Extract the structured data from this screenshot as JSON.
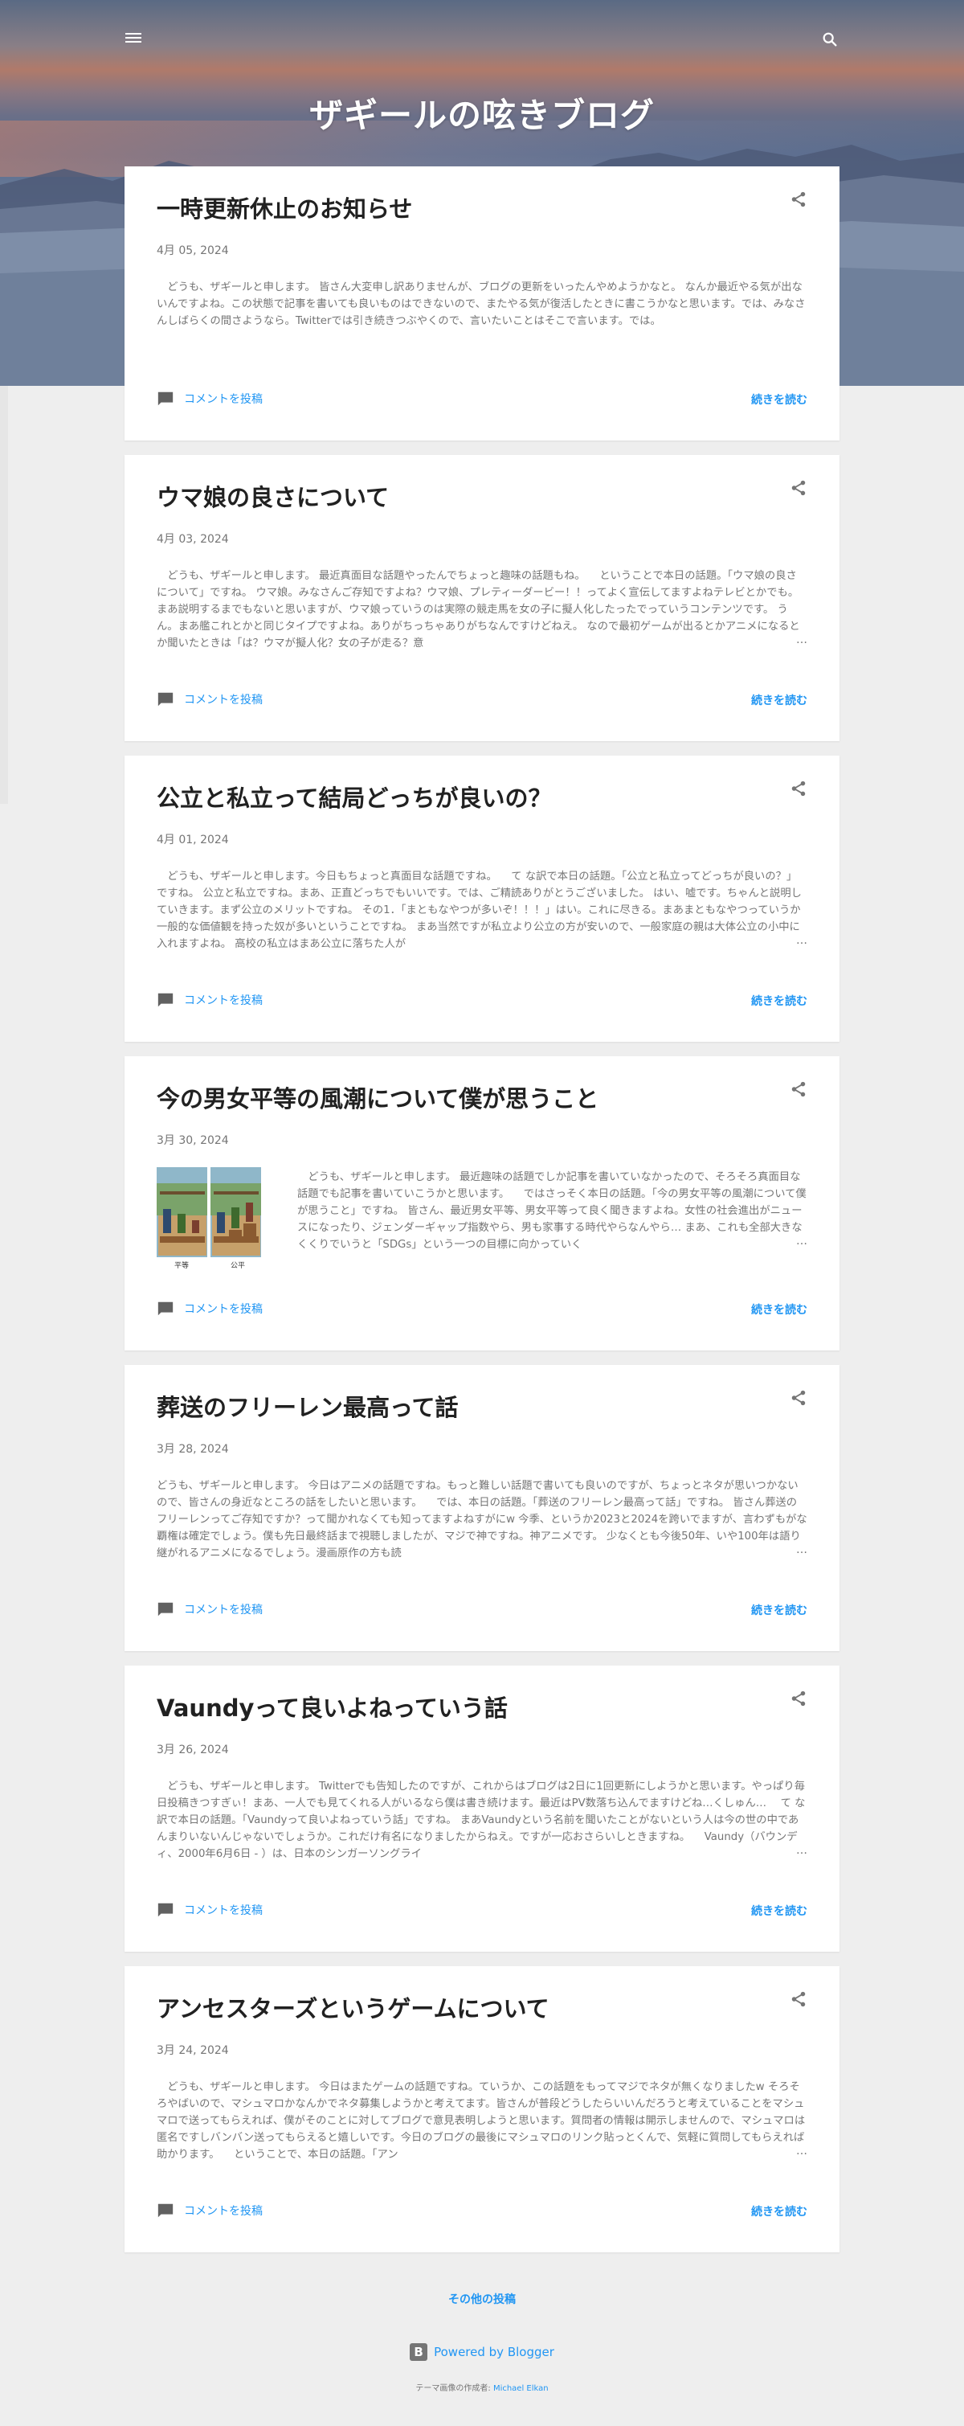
{
  "header": {
    "blog_title": "ザギールの呟きブログ",
    "menu_icon": "hamburger-menu-icon",
    "search_icon": "search-icon"
  },
  "posts": [
    {
      "title": "一時更新休止のお知らせ",
      "date": "4月 05, 2024",
      "snippet": "　どうも、ザギールと申します。 皆さん大変申し訳ありませんが、ブログの更新をいったんやめようかなと。 なんか最近やる気が出ないんですよね。この状態で記事を書いても良いものはできないので、またやる気が復活したときに書こうかなと思います。では、みなさんしばらくの間さようなら。Twitterでは引き続きつぶやくので、言いたいことはそこで言います。では。",
      "truncated": false,
      "comment_label": "コメントを投稿",
      "read_more": "続きを読む"
    },
    {
      "title": "ウマ娘の良さについて",
      "date": "4月 03, 2024",
      "snippet": "　どうも、ザギールと申します。 最近真面目な話題やったんでちょっと趣味の話題もね。 　ということで本日の話題。「ウマ娘の良さについて」ですね。 ウマ娘。みなさんご存知ですよね？ウマ娘、プレティーダービー！！ってよく宣伝してますよねテレビとかでも。まあ説明するまでもないと思いますが、ウマ娘っていうのは実際の競走馬を女の子に擬人化したったでっていうコンテンツです。 うん。まあ艦これとかと同じタイプですよね。ありがちっちゃありがちなんですけどねえ。 なので最初ゲームが出るとかアニメになるとか聞いたときは「は？ウマが擬人化？女の子が走る？意",
      "truncated": true,
      "comment_label": "コメントを投稿",
      "read_more": "続きを読む"
    },
    {
      "title": "公立と私立って結局どっちが良いの？",
      "date": "4月 01, 2024",
      "snippet": "　どうも、ザギールと申します。今日もちょっと真面目な話題ですね。 　て な訳で本日の話題。「公立と私立ってどっちが良いの？」ですね。 公立と私立ですね。まあ、正直どっちでもいいです。では、ご精読ありがとうございました。 はい、嘘です。ちゃんと説明していきます。まず公立のメリットですね。 その1．「まともなやつが多いぞ！！！」はい。これに尽きる。まあまともなやつっていうか一般的な価値観を持った奴が多いということですね。 まあ当然ですが私立より公立の方が安いので、一般家庭の親は大体公立の小中に入れますよね。 高校の私立はまあ公立に落ちた人が",
      "truncated": true,
      "comment_label": "コメントを投稿",
      "read_more": "続きを読む"
    },
    {
      "title": "今の男女平等の風潮について僕が思うこと",
      "date": "3月 30, 2024",
      "has_thumbnail": true,
      "thumbnail_labels": [
        "平等",
        "公平"
      ],
      "snippet": "　どうも、ザギールと申します。 最近趣味の話題でしか記事を書いていなかったので、そろそろ真面目な話題でも記事を書いていこうかと思います。 　ではさっそく本日の話題。「今の男女平等の風潮について僕が思うこと」ですね。 皆さん、最近男女平等、男女平等って良く聞きますよね。女性の社会進出がニュースになったり、ジェンダーギャップ指数やら、男も家事する時代やらなんやら… まあ、これも全部大きなくくりでいうと「SDGs」という一つの目標に向かっていく",
      "truncated": true,
      "comment_label": "コメントを投稿",
      "read_more": "続きを読む"
    },
    {
      "title": "葬送のフリーレン最高って話",
      "date": "3月 28, 2024",
      "snippet": "どうも、ザギールと申します。 今日はアニメの話題ですね。もっと難しい話題で書いても良いのですが、ちょっとネタが思いつかないので、皆さんの身近なところの話をしたいと思います。 　では、本日の話題。「葬送のフリーレン最高って話」ですね。 皆さん葬送のフリーレンってご存知ですか？って聞かれなくても知ってますよねすがにw 今季、というか2023と2024を跨いでますが、言わずもがな覇権は確定でしょう。僕も先日最終話まで視聴しましたが、マジで神ですね。神アニメです。 少なくとも今後50年、いや100年は語り継がれるアニメになるでしょう。漫画原作の方も読",
      "truncated": true,
      "comment_label": "コメントを投稿",
      "read_more": "続きを読む"
    },
    {
      "title": "Vaundyって良いよねっていう話",
      "date": "3月 26, 2024",
      "snippet": "　どうも、ザギールと申します。 Twitterでも告知したのですが、これからはブログは2日に1回更新にしようかと思います。やっぱり毎日投稿きつすぎぃ！まあ、一人でも見てくれる人がいるなら僕は書き続けます。最近はPV数落ち込んでますけどね…くしゅん… 　て な訳で本日の話題。「Vaundyって良いよねっていう話」ですね。 まあVaundyという名前を聞いたことがないという人は今の世の中であんまりいないんじゃないでしょうか。これだけ有名になりましたからねえ。ですが一応おさらいしときますね。 　Vaundy（バウンディ、2000年6月6日 - ）は、日本のシンガーソングライ",
      "truncated": true,
      "comment_label": "コメントを投稿",
      "read_more": "続きを読む"
    },
    {
      "title": "アンセスターズというゲームについて",
      "date": "3月 24, 2024",
      "snippet": "　どうも、ザギールと申します。 今日はまたゲームの話題ですね。ていうか、この話題をもってマジでネタが無くなりましたw そろそろやばいので、マシュマロかなんかでネタ募集しようかと考えてます。皆さんが普段どうしたらいいんだろうと考えていることをマシュマロで送ってもらえれば、僕がそのことに対してブログで意見表明しようと思います。質問者の情報は開示しませんので、マシュマロは匿名ですしバンバン送ってもらえると嬉しいです。今日のブログの最後にマシュマロのリンク貼っとくんで、気軽に質問してもらえれば助かります。 　ということで、本日の話題。「アン",
      "truncated": true,
      "comment_label": "コメントを投稿",
      "read_more": "続きを読む"
    }
  ],
  "footer": {
    "older_posts": "その他の投稿",
    "powered_by": "Powered by Blogger",
    "credit_prefix": "テーマ画像の作成者: ",
    "credit_author": "Michael Elkan"
  },
  "colors": {
    "link": "#2196f3",
    "title": "#212121",
    "muted": "#757575",
    "page_bg": "#eeeeee"
  }
}
